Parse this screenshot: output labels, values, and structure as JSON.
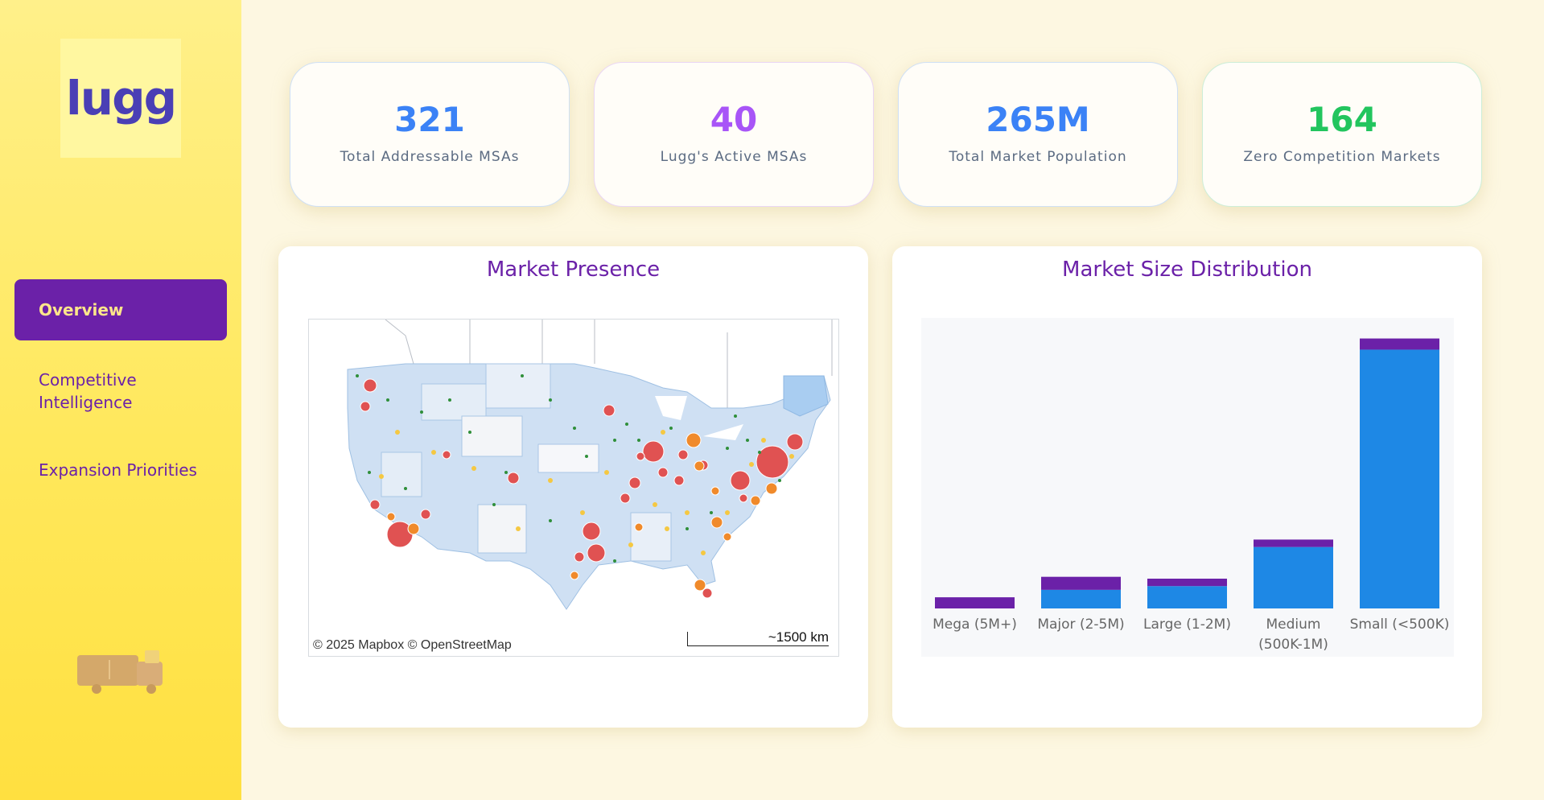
{
  "sidebar": {
    "logo": "lugg",
    "nav": [
      {
        "label": "Overview",
        "active": true
      },
      {
        "label": "Competitive Intelligence",
        "active": false
      },
      {
        "label": "Expansion Priorities",
        "active": false
      }
    ],
    "footer_icon": "truck-icon"
  },
  "kpis": [
    {
      "value": "321",
      "label": "Total Addressable MSAs",
      "color": "#3b82f6"
    },
    {
      "value": "40",
      "label": "Lugg's Active MSAs",
      "color": "#a855f7"
    },
    {
      "value": "265M",
      "label": "Total Market Population",
      "color": "#3b82f6"
    },
    {
      "value": "164",
      "label": "Zero Competition Markets",
      "color": "#22c55e"
    }
  ],
  "map_panel": {
    "title": "Market Presence",
    "attribution": "© 2025 Mapbox  © OpenStreetMap",
    "scale": "~1500 km"
  },
  "chart_panel": {
    "title": "Market Size Distribution"
  },
  "chart_data": {
    "type": "bar",
    "stacked": true,
    "categories": [
      "Mega (5M+)",
      "Major (2-5M)",
      "Large (1-2M)",
      "Medium (500K-1M)",
      "Small (<500K)"
    ],
    "category_lines": [
      [
        "Mega (5M+)"
      ],
      [
        "Major (2-5M)"
      ],
      [
        "Large (1-2M)"
      ],
      [
        "Medium",
        "(500K-1M)"
      ],
      [
        "Small (<500K)"
      ]
    ],
    "series": [
      {
        "values": [
          0,
          10,
          12,
          33,
          139
        ],
        "color": "#1e88e5"
      },
      {
        "values": [
          6,
          7,
          4,
          4,
          6
        ],
        "color": "#6b21a8"
      }
    ],
    "ylim": [
      0,
      150
    ],
    "grid": false,
    "legend": "none"
  }
}
